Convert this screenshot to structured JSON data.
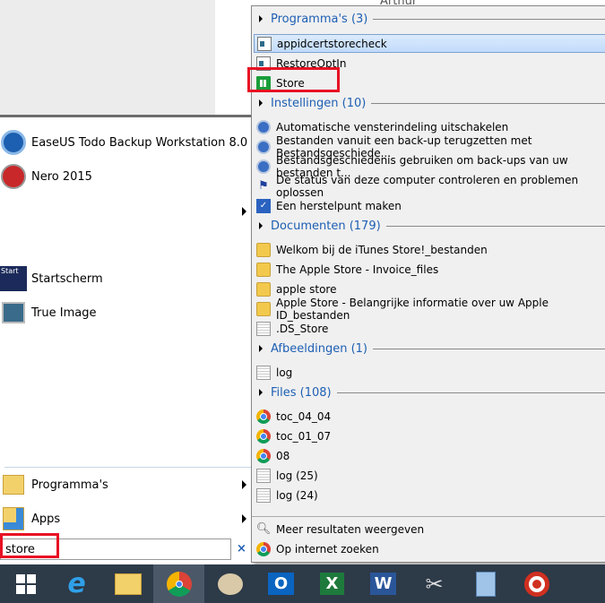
{
  "background": {
    "text": "Arthur"
  },
  "left_menu": {
    "pinned": [
      {
        "label": "EaseUS Todo Backup Workstation 8.0",
        "icon": "easeus-icon"
      },
      {
        "label": "Nero 2015",
        "icon": "nero-icon"
      },
      {
        "label": "Startscherm",
        "icon": "startscreen-icon",
        "icon_text": "Start"
      },
      {
        "label": "True Image",
        "icon": "trueimage-icon"
      }
    ],
    "programs_label": "Programma's",
    "apps_label": "Apps",
    "search_value": "store",
    "clear_label": "×"
  },
  "results": {
    "groups": [
      {
        "title": "Programma's (3)",
        "items": [
          {
            "label": "appidcertstorecheck",
            "icon": "app"
          },
          {
            "label": "RestoreOptIn",
            "icon": "app"
          },
          {
            "label": "Store",
            "icon": "store"
          }
        ]
      },
      {
        "title": "Instellingen (10)",
        "items": [
          {
            "label": "Automatische vensterindeling uitschakelen",
            "icon": "set"
          },
          {
            "label": "Bestanden vanuit een back-up terugzetten met Bestandsgeschiede...",
            "icon": "set"
          },
          {
            "label": "Bestandsgeschiedenis gebruiken om back-ups van uw bestanden t...",
            "icon": "set"
          },
          {
            "label": "De status van deze computer controleren en problemen oplossen",
            "icon": "flag"
          },
          {
            "label": "Een herstelpunt maken",
            "icon": "check"
          }
        ]
      },
      {
        "title": "Documenten (179)",
        "items": [
          {
            "label": "Welkom bij de iTunes Store!_bestanden",
            "icon": "folder"
          },
          {
            "label": "The Apple Store - Invoice_files",
            "icon": "folder"
          },
          {
            "label": "apple store",
            "icon": "folder"
          },
          {
            "label": "Apple Store - Belangrijke informatie over uw Apple ID_bestanden",
            "icon": "folder"
          },
          {
            "label": ".DS_Store",
            "icon": "file"
          }
        ]
      },
      {
        "title": "Afbeeldingen (1)",
        "items": [
          {
            "label": "log",
            "icon": "file"
          }
        ]
      },
      {
        "title": "Files (108)",
        "items": [
          {
            "label": "toc_04_04",
            "icon": "chrome"
          },
          {
            "label": "toc_01_07",
            "icon": "chrome"
          },
          {
            "label": "08",
            "icon": "chrome"
          },
          {
            "label": "log (25)",
            "icon": "file"
          },
          {
            "label": "log (24)",
            "icon": "file"
          }
        ]
      }
    ],
    "more_results": "Meer resultaten weergeven",
    "web_search": "Op internet zoeken"
  },
  "taskbar": {
    "apps": [
      "windows-start",
      "internet-explorer",
      "file-explorer",
      "chrome",
      "paint",
      "outlook",
      "excel",
      "word",
      "snipping-tool",
      "calculator",
      "recorder"
    ],
    "labels": {
      "ie": "e",
      "outlook": "O",
      "excel": "X",
      "word": "W"
    }
  }
}
